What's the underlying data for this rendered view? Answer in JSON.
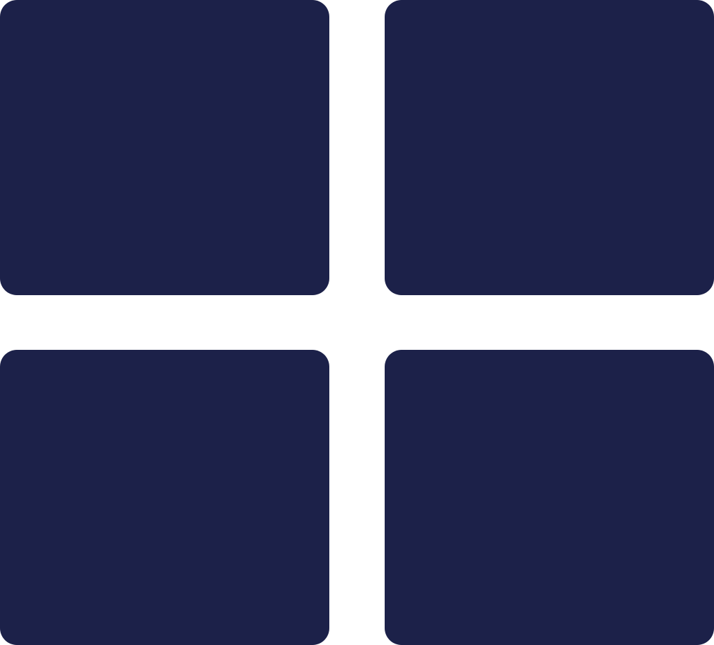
{
  "icon": {
    "name": "grid-view-icon",
    "tile_color": "#1C2149",
    "background_color": "#FFFFFF",
    "tiles": [
      {
        "id": "top-left"
      },
      {
        "id": "top-right"
      },
      {
        "id": "bottom-left"
      },
      {
        "id": "bottom-right"
      }
    ]
  }
}
